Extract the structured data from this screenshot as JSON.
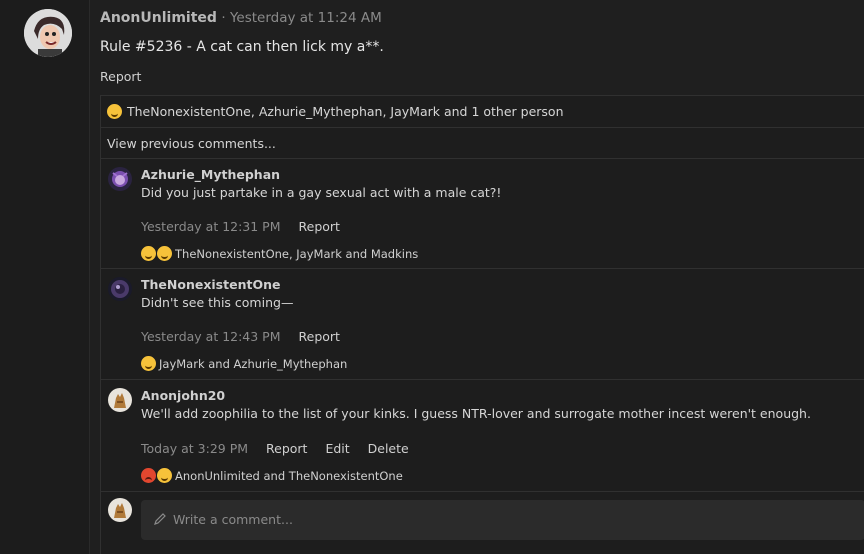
{
  "post": {
    "author": "AnonUnlimited",
    "time": "· Yesterday at 11:24 AM",
    "body": "Rule #5236 - A cat can then lick my a**.",
    "report_label": "Report",
    "reactions_text": "TheNonexistentOne, Azhurie_Mythephan, JayMark and 1 other person"
  },
  "thread": {
    "view_previous": "View previous comments...",
    "comments": [
      {
        "author": "Azhurie_Mythephan",
        "text": "Did you just partake in a gay sexual act with a male cat?!",
        "time": "Yesterday at 12:31 PM",
        "actions": [
          "Report"
        ],
        "reactions": [
          "laugh-emoji",
          "surprised-emoji"
        ],
        "reaction_names": "TheNonexistentOne, JayMark and Madkins"
      },
      {
        "author": "TheNonexistentOne",
        "text": "Didn't see this coming—",
        "time": "Yesterday at 12:43 PM",
        "actions": [
          "Report"
        ],
        "reactions": [
          "laugh-emoji"
        ],
        "reaction_names": "JayMark and Azhurie_Mythephan"
      },
      {
        "author": "Anonjohn20",
        "text": "We'll add zoophilia to the list of your kinks. I guess NTR-lover and surrogate mother incest weren't enough.",
        "time": "Today at 3:29 PM",
        "actions": [
          "Report",
          "Edit",
          "Delete"
        ],
        "reactions": [
          "angry-emoji",
          "laugh-emoji"
        ],
        "reaction_names": "AnonUnlimited and TheNonexistentOne"
      }
    ],
    "write_placeholder": "Write a comment..."
  },
  "colors": {
    "background": "#1f1f1f",
    "text": "#d8d8d8",
    "muted": "#8a8a8a"
  }
}
